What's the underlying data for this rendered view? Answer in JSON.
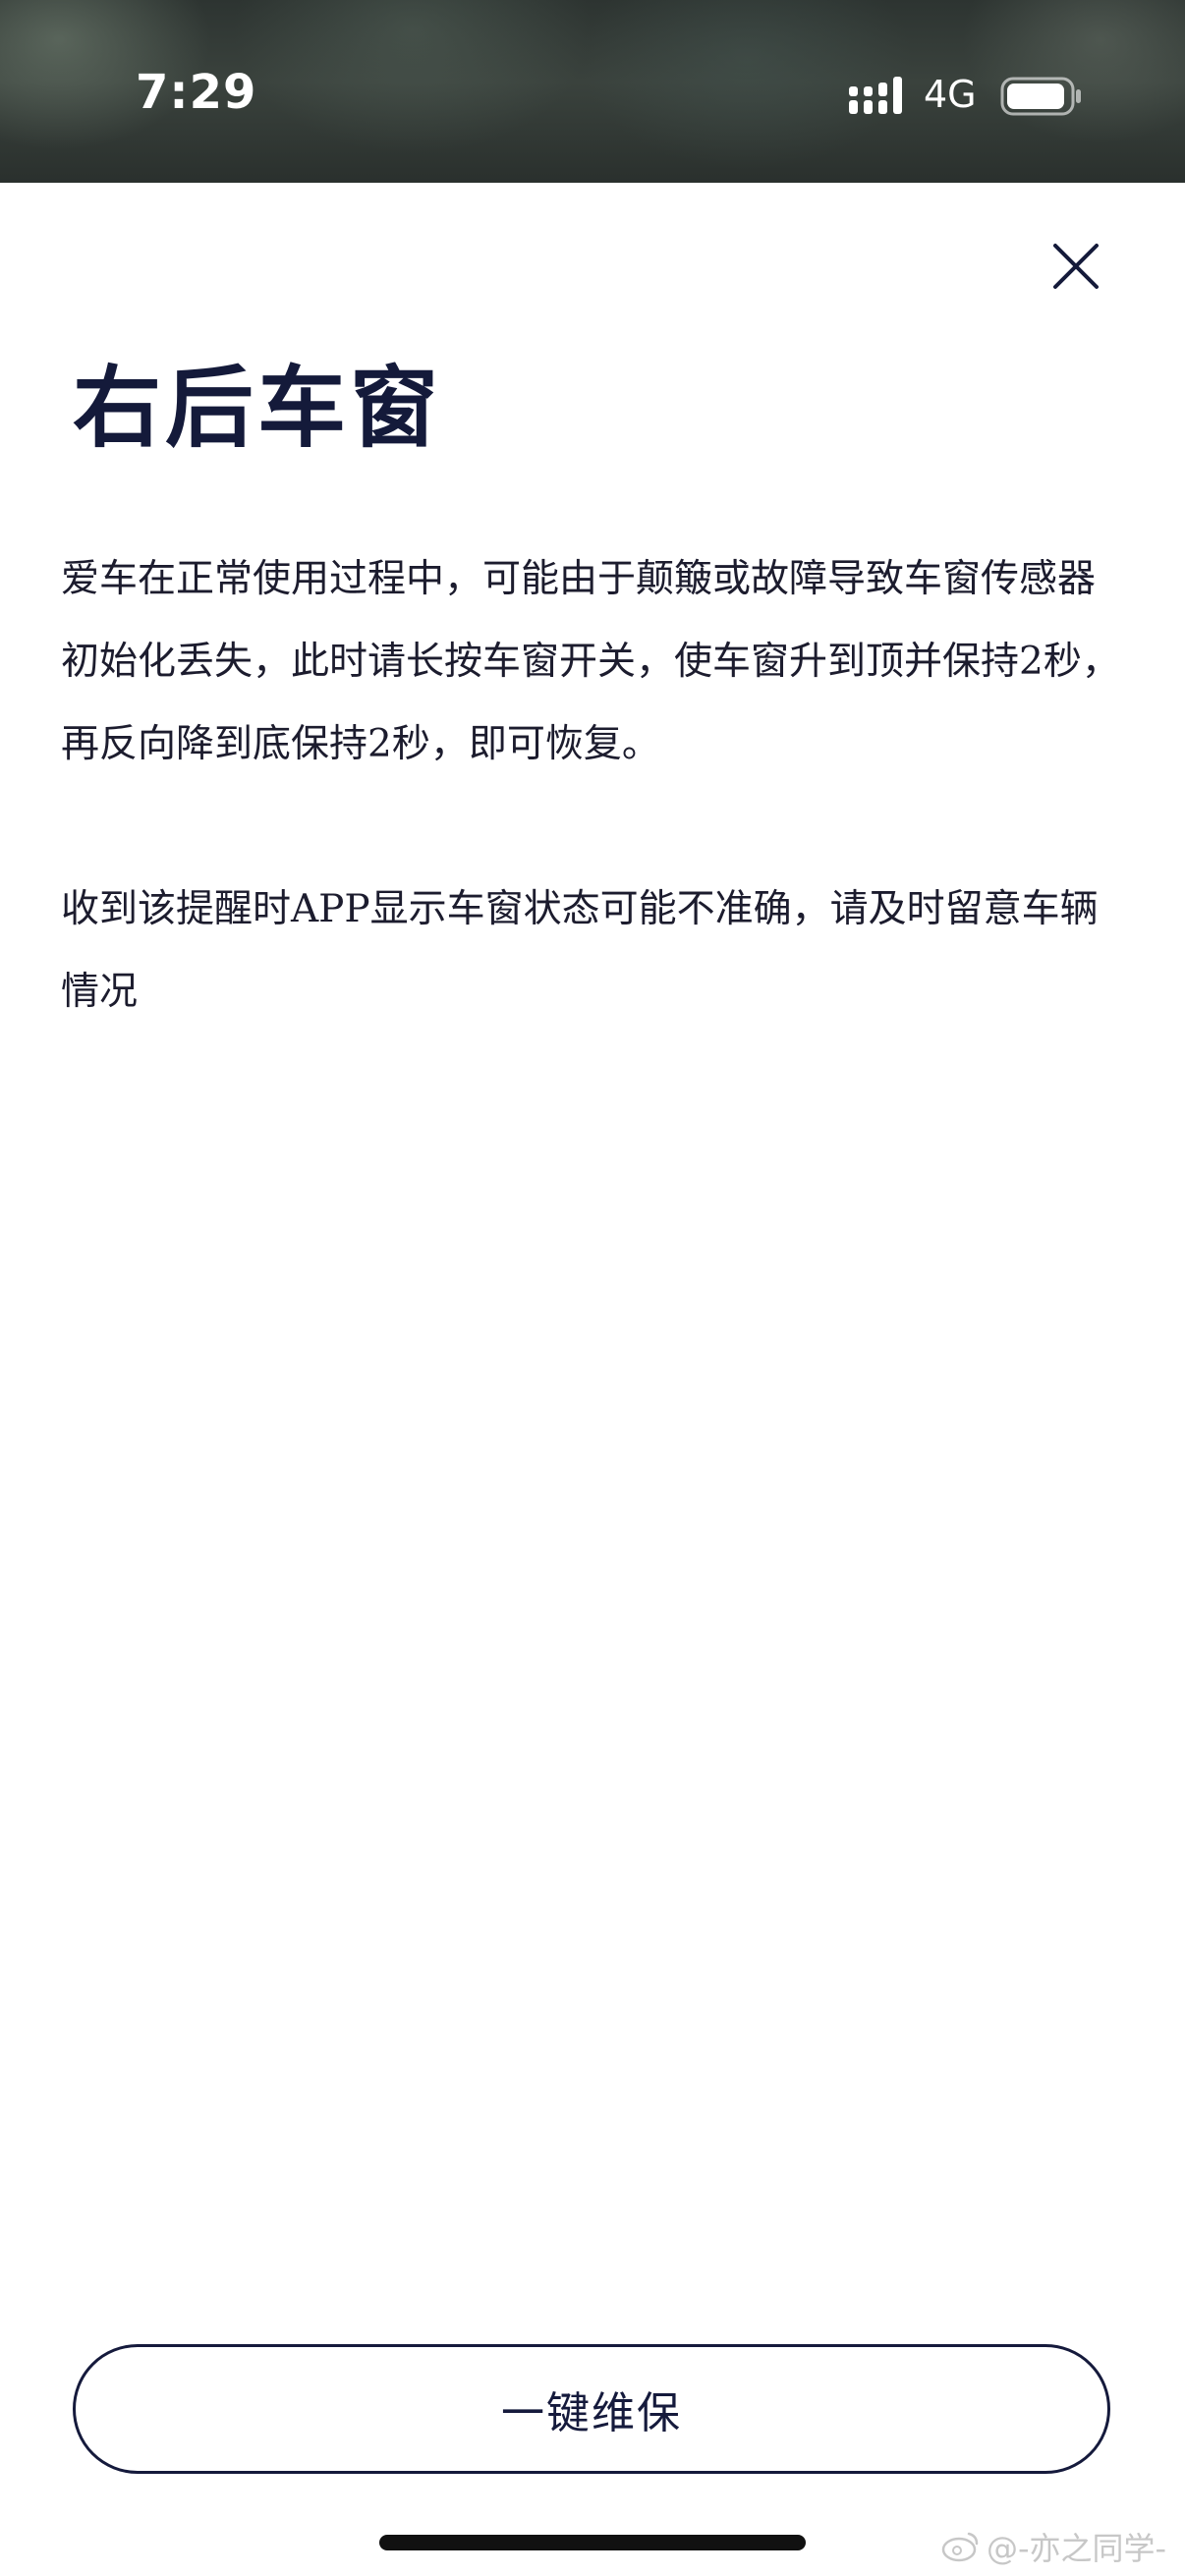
{
  "status_bar": {
    "time": "7:29",
    "network": "4G",
    "signal_icon": "cellular-signal-icon",
    "battery_icon": "battery-icon"
  },
  "header": {
    "close_icon": "close-icon",
    "title": "右后车窗"
  },
  "content": {
    "paragraphs": [
      "爱车在正常使用过程中，可能由于颠簸或故障导致车窗传感器初始化丢失，此时请长按车窗开关，使车窗升到顶并保持2秒，再反向降到底保持2秒，即可恢复。",
      "收到该提醒时APP显示车窗状态可能不准确，请及时留意车辆情况"
    ]
  },
  "footer": {
    "button_label": "一键维保"
  },
  "watermark": {
    "text": "@-亦之同学-",
    "icon": "weibo-icon"
  },
  "colors": {
    "primary_dark": "#141a3a",
    "background": "#ffffff",
    "status_bar_bg": "#323a36"
  }
}
